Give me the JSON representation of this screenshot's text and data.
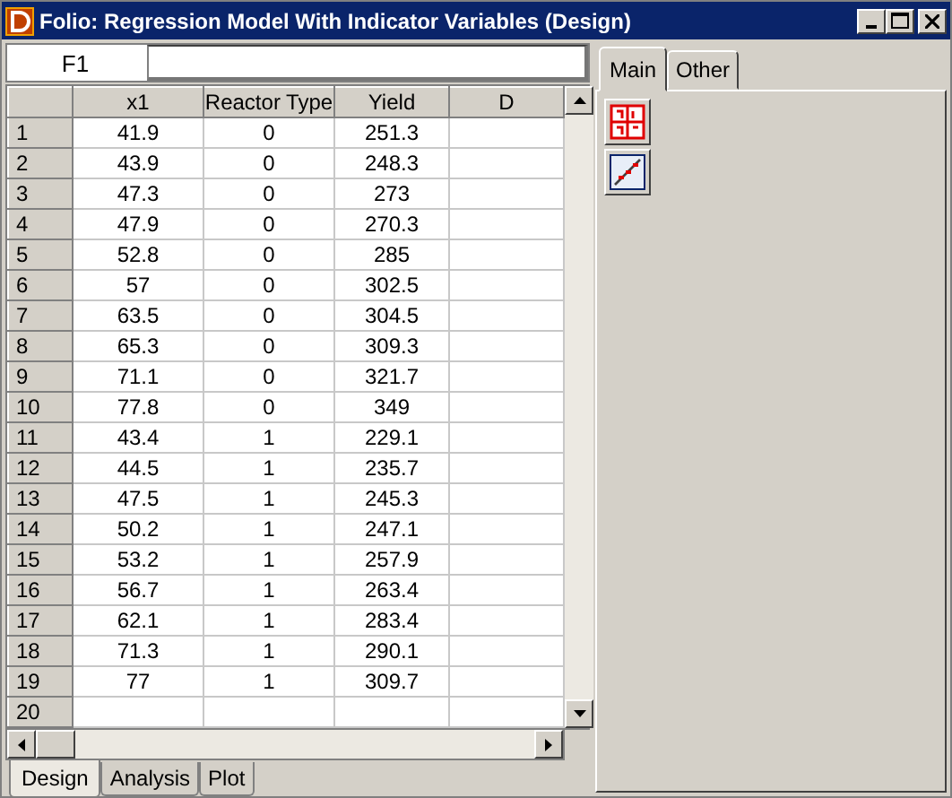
{
  "window": {
    "title": "Folio: Regression Model With Indicator Variables (Design)"
  },
  "cell_reference": "F1",
  "table": {
    "columns": [
      "x1",
      "Reactor Type",
      "Yield",
      "D"
    ],
    "rows": [
      {
        "number": "1",
        "cells": [
          "41.9",
          "0",
          "251.3"
        ]
      },
      {
        "number": "2",
        "cells": [
          "43.9",
          "0",
          "248.3"
        ]
      },
      {
        "number": "3",
        "cells": [
          "47.3",
          "0",
          "273"
        ]
      },
      {
        "number": "4",
        "cells": [
          "47.9",
          "0",
          "270.3"
        ]
      },
      {
        "number": "5",
        "cells": [
          "52.8",
          "0",
          "285"
        ]
      },
      {
        "number": "6",
        "cells": [
          "57",
          "0",
          "302.5"
        ]
      },
      {
        "number": "7",
        "cells": [
          "63.5",
          "0",
          "304.5"
        ]
      },
      {
        "number": "8",
        "cells": [
          "65.3",
          "0",
          "309.3"
        ]
      },
      {
        "number": "9",
        "cells": [
          "71.1",
          "0",
          "321.7"
        ]
      },
      {
        "number": "10",
        "cells": [
          "77.8",
          "0",
          "349"
        ]
      },
      {
        "number": "11",
        "cells": [
          "43.4",
          "1",
          "229.1"
        ]
      },
      {
        "number": "12",
        "cells": [
          "44.5",
          "1",
          "235.7"
        ]
      },
      {
        "number": "13",
        "cells": [
          "47.5",
          "1",
          "245.3"
        ]
      },
      {
        "number": "14",
        "cells": [
          "50.2",
          "1",
          "247.1"
        ]
      },
      {
        "number": "15",
        "cells": [
          "53.2",
          "1",
          "257.9"
        ]
      },
      {
        "number": "16",
        "cells": [
          "56.7",
          "1",
          "263.4"
        ]
      },
      {
        "number": "17",
        "cells": [
          "62.1",
          "1",
          "283.4"
        ]
      },
      {
        "number": "18",
        "cells": [
          "71.3",
          "1",
          "290.1"
        ]
      },
      {
        "number": "19",
        "cells": [
          "77",
          "1",
          "309.7"
        ]
      },
      {
        "number": "20",
        "cells": []
      }
    ]
  },
  "sheet_tabs": [
    {
      "label": "Design",
      "selected": true
    },
    {
      "label": "Analysis",
      "selected": false
    },
    {
      "label": "Plot",
      "selected": false
    }
  ],
  "side_tabs": [
    {
      "label": "Main",
      "selected": true
    },
    {
      "label": "Other",
      "selected": false
    }
  ],
  "tools": [
    {
      "kind": "parameters"
    },
    {
      "kind": "regression"
    }
  ]
}
